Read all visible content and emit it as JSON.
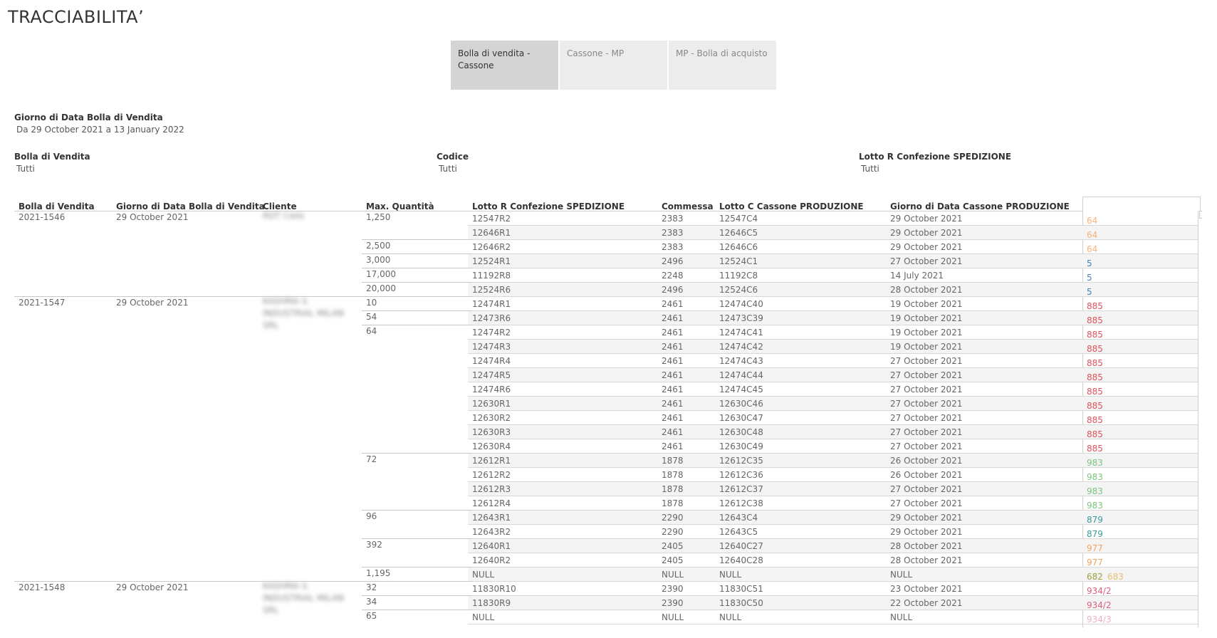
{
  "page": {
    "title": "TRACCIABILITA’"
  },
  "tabs": [
    {
      "label": "Bolla di vendita - Cassone",
      "active": true
    },
    {
      "label": "Cassone - MP",
      "active": false
    },
    {
      "label": "MP - Bolla di acquisto",
      "active": false
    }
  ],
  "filters": {
    "date": {
      "label": "Giorno di Data Bolla di Vendita",
      "value": "Da 29 October 2021 a 13 January 2022"
    },
    "bolla": {
      "label": "Bolla di Vendita",
      "value": "Tutti"
    },
    "codice": {
      "label": "Codice",
      "value": "Tutti"
    },
    "lotto": {
      "label": "Lotto R Confezione SPEDIZIONE",
      "value": "Tutti"
    }
  },
  "colors": {
    "orange": "#f4a460",
    "blue": "#4a7fb5",
    "red": "#e0525a",
    "green": "#7cc47c",
    "teal": "#3a9a9a",
    "yellow": "#e8c070",
    "pink": "#e0607a",
    "lightpink": "#f0b0c0",
    "lightorange": "#f7b27a"
  },
  "table": {
    "headers": [
      "Bolla di Vendita",
      "Giorno di Data Bolla di Vendita",
      "Cliente",
      "Max. Quantità",
      "Lotto R Confezione SPEDIZIONE",
      "Commessa",
      "Lotto C Cassone PRODUZIONE",
      "Giorno di Data Cassone PRODUZIONE"
    ],
    "groups": [
      {
        "bolla": "2021-1546",
        "giorno": "29 October 2021",
        "cliente": "RDT Cielo",
        "start": 0
      },
      {
        "bolla": "2021-1547",
        "giorno": "29 October 2021",
        "cliente": "KASHMA S INDUSTRIAL MILAN SRL",
        "start": 6
      },
      {
        "bolla": "2021-1548",
        "giorno": "29 October 2021",
        "cliente": "KASHMA S INDUSTRIAL MILAN SRL",
        "start": 26
      }
    ],
    "quantities": [
      {
        "value": "1,250",
        "start": 0
      },
      {
        "value": "2,500",
        "start": 2
      },
      {
        "value": "3,000",
        "start": 3
      },
      {
        "value": "17,000",
        "start": 4
      },
      {
        "value": "20,000",
        "start": 5
      },
      {
        "value": "10",
        "start": 6
      },
      {
        "value": "54",
        "start": 7
      },
      {
        "value": "64",
        "start": 8
      },
      {
        "value": "72",
        "start": 17
      },
      {
        "value": "96",
        "start": 21
      },
      {
        "value": "392",
        "start": 23
      },
      {
        "value": "1,195",
        "start": 25
      },
      {
        "value": "32",
        "start": 26
      },
      {
        "value": "34",
        "start": 27
      },
      {
        "value": "65",
        "start": 28
      }
    ],
    "rows": [
      {
        "lotto": "12547R2",
        "commessa": "2383",
        "cassone": "12547C4",
        "giorno": "29 October 2021",
        "codes": [
          {
            "t": "64",
            "c": "lightorange"
          }
        ]
      },
      {
        "lotto": "12646R1",
        "commessa": "2383",
        "cassone": "12646C5",
        "giorno": "29 October 2021",
        "codes": [
          {
            "t": "64",
            "c": "lightorange"
          }
        ]
      },
      {
        "lotto": "12646R2",
        "commessa": "2383",
        "cassone": "12646C6",
        "giorno": "29 October 2021",
        "codes": [
          {
            "t": "64",
            "c": "lightorange"
          }
        ]
      },
      {
        "lotto": "12524R1",
        "commessa": "2496",
        "cassone": "12524C1",
        "giorno": "27 October 2021",
        "codes": [
          {
            "t": "5",
            "c": "blue"
          }
        ]
      },
      {
        "lotto": "11192R8",
        "commessa": "2248",
        "cassone": "11192C8",
        "giorno": "14 July 2021",
        "codes": [
          {
            "t": "5",
            "c": "blue"
          }
        ]
      },
      {
        "lotto": "12524R6",
        "commessa": "2496",
        "cassone": "12524C6",
        "giorno": "28 October 2021",
        "codes": [
          {
            "t": "5",
            "c": "blue"
          }
        ]
      },
      {
        "lotto": "12474R1",
        "commessa": "2461",
        "cassone": "12474C40",
        "giorno": "19 October 2021",
        "codes": [
          {
            "t": "885",
            "c": "red"
          }
        ]
      },
      {
        "lotto": "12473R6",
        "commessa": "2461",
        "cassone": "12473C39",
        "giorno": "19 October 2021",
        "codes": [
          {
            "t": "885",
            "c": "red"
          }
        ]
      },
      {
        "lotto": "12474R2",
        "commessa": "2461",
        "cassone": "12474C41",
        "giorno": "19 October 2021",
        "codes": [
          {
            "t": "885",
            "c": "red"
          }
        ]
      },
      {
        "lotto": "12474R3",
        "commessa": "2461",
        "cassone": "12474C42",
        "giorno": "19 October 2021",
        "codes": [
          {
            "t": "885",
            "c": "red"
          }
        ]
      },
      {
        "lotto": "12474R4",
        "commessa": "2461",
        "cassone": "12474C43",
        "giorno": "27 October 2021",
        "codes": [
          {
            "t": "885",
            "c": "red"
          }
        ]
      },
      {
        "lotto": "12474R5",
        "commessa": "2461",
        "cassone": "12474C44",
        "giorno": "27 October 2021",
        "codes": [
          {
            "t": "885",
            "c": "red"
          }
        ]
      },
      {
        "lotto": "12474R6",
        "commessa": "2461",
        "cassone": "12474C45",
        "giorno": "27 October 2021",
        "codes": [
          {
            "t": "885",
            "c": "red"
          }
        ]
      },
      {
        "lotto": "12630R1",
        "commessa": "2461",
        "cassone": "12630C46",
        "giorno": "27 October 2021",
        "codes": [
          {
            "t": "885",
            "c": "red"
          }
        ]
      },
      {
        "lotto": "12630R2",
        "commessa": "2461",
        "cassone": "12630C47",
        "giorno": "27 October 2021",
        "codes": [
          {
            "t": "885",
            "c": "red"
          }
        ]
      },
      {
        "lotto": "12630R3",
        "commessa": "2461",
        "cassone": "12630C48",
        "giorno": "27 October 2021",
        "codes": [
          {
            "t": "885",
            "c": "red"
          }
        ]
      },
      {
        "lotto": "12630R4",
        "commessa": "2461",
        "cassone": "12630C49",
        "giorno": "27 October 2021",
        "codes": [
          {
            "t": "885",
            "c": "red"
          }
        ]
      },
      {
        "lotto": "12612R1",
        "commessa": "1878",
        "cassone": "12612C35",
        "giorno": "26 October 2021",
        "codes": [
          {
            "t": "983",
            "c": "green"
          }
        ]
      },
      {
        "lotto": "12612R2",
        "commessa": "1878",
        "cassone": "12612C36",
        "giorno": "26 October 2021",
        "codes": [
          {
            "t": "983",
            "c": "green"
          }
        ]
      },
      {
        "lotto": "12612R3",
        "commessa": "1878",
        "cassone": "12612C37",
        "giorno": "27 October 2021",
        "codes": [
          {
            "t": "983",
            "c": "green"
          }
        ]
      },
      {
        "lotto": "12612R4",
        "commessa": "1878",
        "cassone": "12612C38",
        "giorno": "27 October 2021",
        "codes": [
          {
            "t": "983",
            "c": "green"
          }
        ]
      },
      {
        "lotto": "12643R1",
        "commessa": "2290",
        "cassone": "12643C4",
        "giorno": "29 October 2021",
        "codes": [
          {
            "t": "879",
            "c": "teal"
          }
        ]
      },
      {
        "lotto": "12643R2",
        "commessa": "2290",
        "cassone": "12643C5",
        "giorno": "29 October 2021",
        "codes": [
          {
            "t": "879",
            "c": "teal"
          }
        ]
      },
      {
        "lotto": "12640R1",
        "commessa": "2405",
        "cassone": "12640C27",
        "giorno": "28 October 2021",
        "codes": [
          {
            "t": "977",
            "c": "orange"
          }
        ]
      },
      {
        "lotto": "12640R2",
        "commessa": "2405",
        "cassone": "12640C28",
        "giorno": "28 October 2021",
        "codes": [
          {
            "t": "977",
            "c": "orange"
          }
        ]
      },
      {
        "lotto": "NULL",
        "commessa": "NULL",
        "cassone": "NULL",
        "giorno": "NULL",
        "codes": [
          {
            "t": "682",
            "c": "olive"
          },
          {
            "t": "683",
            "c": "yellow"
          }
        ]
      },
      {
        "lotto": "11830R10",
        "commessa": "2390",
        "cassone": "11830C51",
        "giorno": "23 October 2021",
        "codes": [
          {
            "t": "934/2",
            "c": "pink"
          }
        ]
      },
      {
        "lotto": "11830R9",
        "commessa": "2390",
        "cassone": "11830C50",
        "giorno": "22 October 2021",
        "codes": [
          {
            "t": "934/2",
            "c": "pink"
          }
        ]
      },
      {
        "lotto": "NULL",
        "commessa": "NULL",
        "cassone": "NULL",
        "giorno": "NULL",
        "codes": [
          {
            "t": "934/3",
            "c": "lightpink"
          }
        ]
      }
    ]
  }
}
